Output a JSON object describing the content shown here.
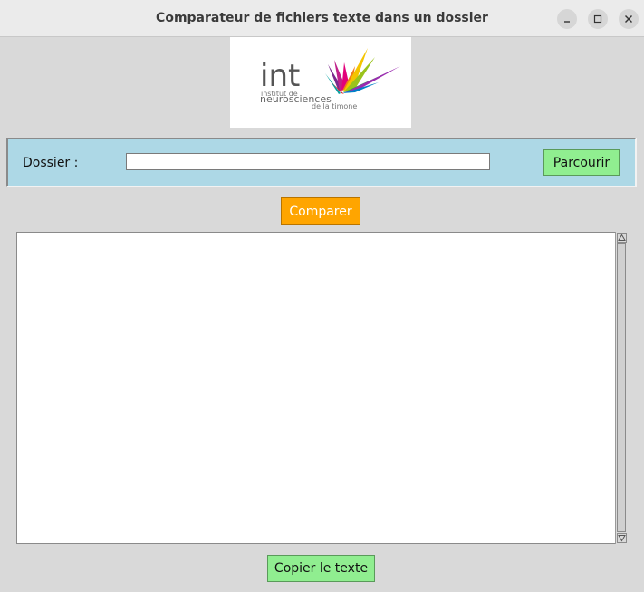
{
  "window": {
    "title": "Comparateur de fichiers texte dans un dossier",
    "controls": [
      "minimize-icon",
      "maximize-icon",
      "close-icon"
    ]
  },
  "logo": {
    "acronym": "int",
    "line1": "institut de",
    "line2": "neurosciences",
    "line3": "de la timone"
  },
  "folder": {
    "label": "Dossier :",
    "value": "",
    "browse_label": "Parcourir"
  },
  "actions": {
    "compare_label": "Comparer",
    "copy_label": "Copier le texte"
  },
  "output": {
    "text": ""
  },
  "colors": {
    "frame_bg": "#add8e6",
    "browse_bg": "#90ee90",
    "compare_bg": "#ffa500",
    "copy_bg": "#90ee90",
    "window_bg": "#d9d9d9"
  }
}
